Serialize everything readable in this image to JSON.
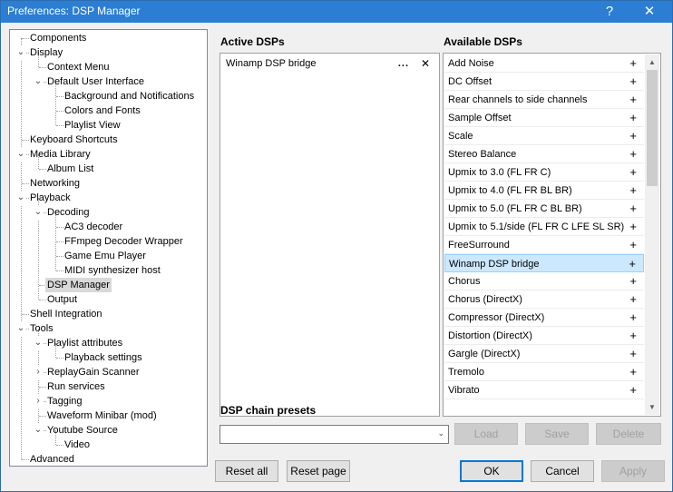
{
  "window": {
    "title": "Preferences: DSP Manager",
    "help_label": "?",
    "close_label": "✕"
  },
  "tree": {
    "items": [
      {
        "label": "Components"
      },
      {
        "label": "Display",
        "expander": "⌄"
      },
      {
        "label": "Context Menu"
      },
      {
        "label": "Default User Interface",
        "expander": "⌄"
      },
      {
        "label": "Background and Notifications"
      },
      {
        "label": "Colors and Fonts"
      },
      {
        "label": "Playlist View"
      },
      {
        "label": "Keyboard Shortcuts"
      },
      {
        "label": "Media Library",
        "expander": "⌄"
      },
      {
        "label": "Album List"
      },
      {
        "label": "Networking"
      },
      {
        "label": "Playback",
        "expander": "⌄"
      },
      {
        "label": "Decoding",
        "expander": "⌄"
      },
      {
        "label": "AC3 decoder"
      },
      {
        "label": "FFmpeg Decoder Wrapper"
      },
      {
        "label": "Game Emu Player"
      },
      {
        "label": "MIDI synthesizer host"
      },
      {
        "label": "DSP Manager",
        "selected": true
      },
      {
        "label": "Output"
      },
      {
        "label": "Shell Integration"
      },
      {
        "label": "Tools",
        "expander": "⌄"
      },
      {
        "label": "Playlist attributes",
        "expander": "⌄"
      },
      {
        "label": "Playback settings"
      },
      {
        "label": "ReplayGain Scanner",
        "expander": "›"
      },
      {
        "label": "Run services"
      },
      {
        "label": "Tagging",
        "expander": "›"
      },
      {
        "label": "Waveform Minibar (mod)"
      },
      {
        "label": "Youtube Source",
        "expander": "⌄"
      },
      {
        "label": "Video"
      },
      {
        "label": "Advanced"
      }
    ]
  },
  "active_dsps": {
    "title": "Active DSPs",
    "items": [
      {
        "label": "Winamp DSP bridge",
        "more_label": "...",
        "remove_label": "✕"
      }
    ]
  },
  "available_dsps": {
    "title": "Available DSPs",
    "add_label": "+",
    "items": [
      "Add Noise",
      "DC Offset",
      "Rear channels to side channels",
      "Sample Offset",
      "Scale",
      "Stereo Balance",
      "Upmix to 3.0 (FL FR C)",
      "Upmix to 4.0 (FL FR BL BR)",
      "Upmix to 5.0 (FL FR C BL BR)",
      "Upmix to 5.1/side (FL FR C LFE SL SR)",
      "FreeSurround",
      "Winamp DSP bridge",
      "Chorus",
      "Chorus (DirectX)",
      "Compressor (DirectX)",
      "Distortion (DirectX)",
      "Gargle (DirectX)",
      "Tremolo",
      "Vibrato"
    ],
    "highlighted": "Winamp DSP bridge",
    "scroll_up": "▲",
    "scroll_down": "▼"
  },
  "presets": {
    "title": "DSP chain presets",
    "combo_value": "",
    "combo_arrow": "⌄",
    "load_label": "Load",
    "save_label": "Save",
    "delete_label": "Delete"
  },
  "footer": {
    "reset_all_label": "Reset all",
    "reset_page_label": "Reset page",
    "ok_label": "OK",
    "cancel_label": "Cancel",
    "apply_label": "Apply"
  },
  "colors": {
    "titlebar": "#2b7ed3",
    "highlight": "#cce8ff",
    "default_button_border": "#0078d7"
  }
}
